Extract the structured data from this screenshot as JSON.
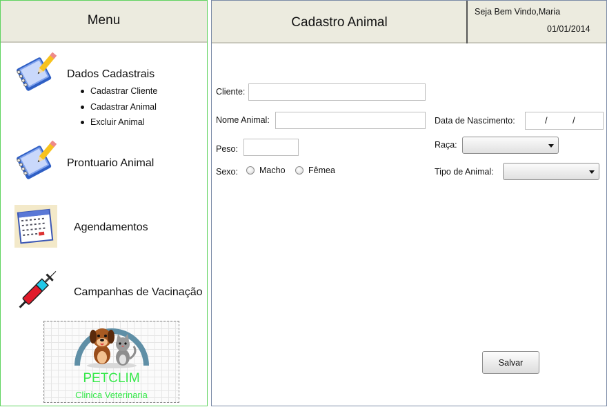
{
  "menu": {
    "title": "Menu",
    "items": [
      {
        "label": "Dados Cadastrais",
        "icon": "notebook-pencil-icon",
        "subitems": [
          "Cadastrar Cliente",
          "Cadastrar Animal",
          "Excluir Animal"
        ]
      },
      {
        "label": "Prontuario Animal",
        "icon": "notebook-pencil-icon"
      },
      {
        "label": "Agendamentos",
        "icon": "calendar-icon"
      },
      {
        "label": "Campanhas de Vacinação",
        "icon": "syringe-icon"
      }
    ],
    "logo": {
      "name": "PETCLIM",
      "subtitle": "Clinica Veterinaria",
      "color": "#36e84a"
    }
  },
  "header": {
    "title": "Cadastro Animal",
    "welcome": "Seja Bem Vindo,Maria",
    "date": "01/01/2014"
  },
  "form": {
    "cliente": {
      "label": "Cliente:",
      "value": ""
    },
    "nome_animal": {
      "label": "Nome Animal:",
      "value": ""
    },
    "peso": {
      "label": "Peso:",
      "value": ""
    },
    "sexo": {
      "label": "Sexo:",
      "options": [
        "Macho",
        "Fêmea"
      ],
      "selected": null
    },
    "data_nascimento": {
      "label": "Data de Nascimento:",
      "separator": "/"
    },
    "raca": {
      "label": "Raça:",
      "selected": ""
    },
    "tipo_animal": {
      "label": "Tipo de Animal:",
      "selected": ""
    },
    "save_label": "Salvar"
  },
  "colors": {
    "header_bg": "#ecebdf",
    "menu_border": "#5ed35e",
    "logo_text": "#36e84a"
  }
}
